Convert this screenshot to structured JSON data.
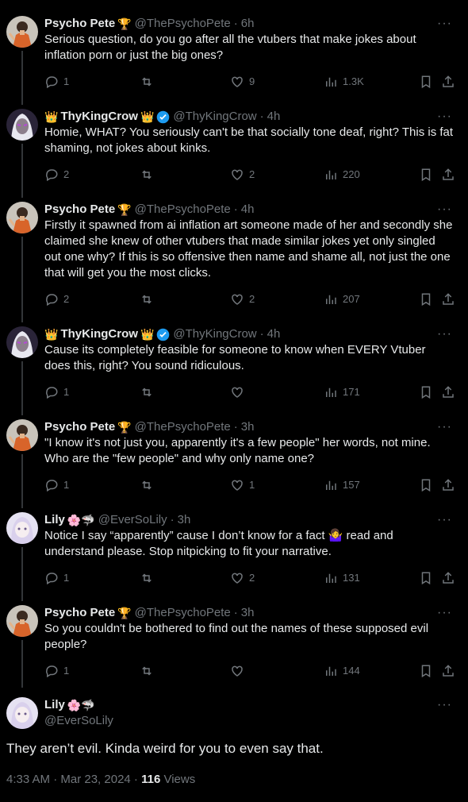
{
  "tweets": [
    {
      "name": "Psycho Pete",
      "emoji": "🏆",
      "handle": "@ThePsychoPete",
      "time": "6h",
      "text": "Serious question, do you go after all the vtubers that make jokes about inflation porn or just the big ones?",
      "reply": "1",
      "retweet": "",
      "like": "9",
      "views": "1.3K"
    },
    {
      "name": "ThyKingCrow",
      "emoji_pre": "👑",
      "emoji": "👑",
      "handle": "@ThyKingCrow",
      "time": "4h",
      "text": "Homie, WHAT? You seriously can't be that socially tone deaf, right? This is fat shaming, not jokes about kinks.",
      "reply": "2",
      "retweet": "",
      "like": "2",
      "views": "220"
    },
    {
      "name": "Psycho Pete",
      "emoji": "🏆",
      "handle": "@ThePsychoPete",
      "time": "4h",
      "text": "Firstly it spawned from ai inflation art someone made of her and secondly she claimed she knew of other vtubers that made similar jokes yet only singled out one why? If this is so offensive then name and shame all, not just the one that will get you the most clicks.",
      "reply": "2",
      "retweet": "",
      "like": "2",
      "views": "207"
    },
    {
      "name": "ThyKingCrow",
      "emoji_pre": "👑",
      "emoji": "👑",
      "handle": "@ThyKingCrow",
      "time": "4h",
      "text": "Cause its completely feasible for someone to know when EVERY Vtuber does this, right? You sound ridiculous.",
      "reply": "1",
      "retweet": "",
      "like": "",
      "views": "171"
    },
    {
      "name": "Psycho Pete",
      "emoji": "🏆",
      "handle": "@ThePsychoPete",
      "time": "3h",
      "text": "\"I know it's not just you, apparently it's a few people\" her words, not mine. Who are the \"few people\" and why only name one?",
      "reply": "1",
      "retweet": "",
      "like": "1",
      "views": "157"
    },
    {
      "name": "Lily",
      "emoji": "🌸🦈",
      "handle": "@EverSoLily",
      "time": "3h",
      "text": "Notice I say “apparently” cause I don’t know for a fact 🤷‍♀️ read and understand please. Stop nitpicking to fit your narrative.",
      "reply": "1",
      "retweet": "",
      "like": "2",
      "views": "131"
    },
    {
      "name": "Psycho Pete",
      "emoji": "🏆",
      "handle": "@ThePsychoPete",
      "time": "3h",
      "text": "So you couldn't be bothered to find out the names of these supposed evil people?",
      "reply": "1",
      "retweet": "",
      "like": "",
      "views": "144"
    }
  ],
  "main": {
    "name": "Lily",
    "emoji": "🌸🦈",
    "handle": "@EverSoLily",
    "text": "They aren’t evil. Kinda weird for you to even say that.",
    "timestamp": "4:33 AM · Mar 23, 2024 · ",
    "views_count": "116",
    "views_label": " Views"
  },
  "icons": {
    "reply": "reply-icon",
    "retweet": "retweet-icon",
    "like": "heart-icon",
    "views": "analytics-icon",
    "bookmark": "bookmark-icon",
    "share": "share-icon",
    "verified": "verified-badge-icon"
  },
  "colors": {
    "background": "#000000",
    "text": "#e7e9ea",
    "muted": "#71767b",
    "verified": "#1d9bf0",
    "thread": "#333639"
  }
}
